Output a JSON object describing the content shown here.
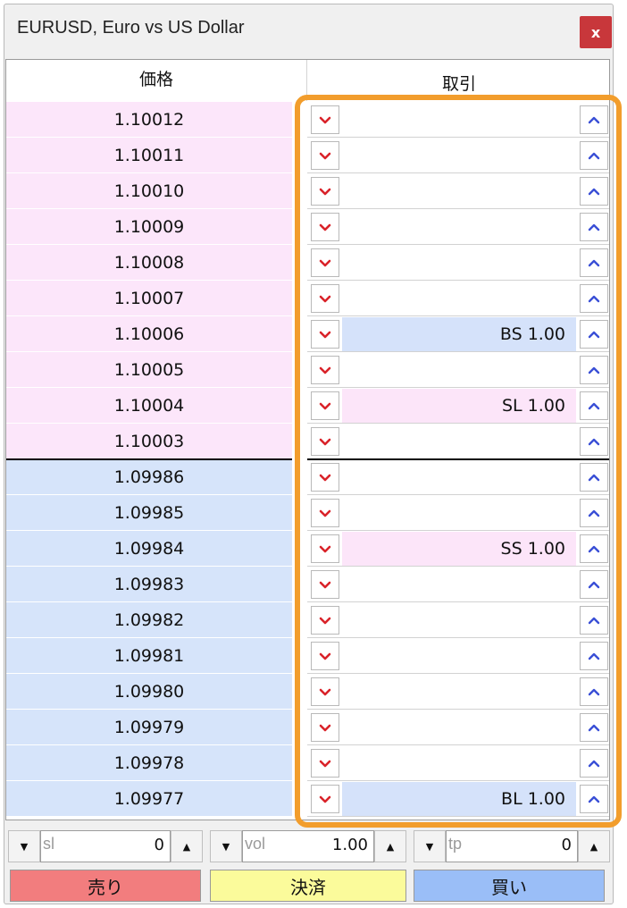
{
  "window": {
    "title": "EURUSD, Euro vs US Dollar",
    "close_label": "x"
  },
  "headers": {
    "price": "価格",
    "trade": "取引"
  },
  "price_rows": [
    {
      "price": "1.10012",
      "side": "ask",
      "order": ""
    },
    {
      "price": "1.10011",
      "side": "ask",
      "order": ""
    },
    {
      "price": "1.10010",
      "side": "ask",
      "order": ""
    },
    {
      "price": "1.10009",
      "side": "ask",
      "order": ""
    },
    {
      "price": "1.10008",
      "side": "ask",
      "order": ""
    },
    {
      "price": "1.10007",
      "side": "ask",
      "order": ""
    },
    {
      "price": "1.10006",
      "side": "ask",
      "order": "BS 1.00",
      "order_type": "buy"
    },
    {
      "price": "1.10005",
      "side": "ask",
      "order": ""
    },
    {
      "price": "1.10004",
      "side": "ask",
      "order": "SL 1.00",
      "order_type": "sell"
    },
    {
      "price": "1.10003",
      "side": "ask",
      "order": ""
    },
    {
      "price": "1.09986",
      "side": "bid",
      "order": ""
    },
    {
      "price": "1.09985",
      "side": "bid",
      "order": ""
    },
    {
      "price": "1.09984",
      "side": "bid",
      "order": "SS 1.00",
      "order_type": "sell"
    },
    {
      "price": "1.09983",
      "side": "bid",
      "order": ""
    },
    {
      "price": "1.09982",
      "side": "bid",
      "order": ""
    },
    {
      "price": "1.09981",
      "side": "bid",
      "order": ""
    },
    {
      "price": "1.09980",
      "side": "bid",
      "order": ""
    },
    {
      "price": "1.09979",
      "side": "bid",
      "order": ""
    },
    {
      "price": "1.09978",
      "side": "bid",
      "order": ""
    },
    {
      "price": "1.09977",
      "side": "bid",
      "order": "BL 1.00",
      "order_type": "buy"
    }
  ],
  "controls": {
    "sl": {
      "label": "sl",
      "value": "0"
    },
    "vol": {
      "label": "vol",
      "value": "1.00"
    },
    "tp": {
      "label": "tp",
      "value": "0"
    }
  },
  "actions": {
    "sell": "売り",
    "close": "決済",
    "buy": "買い"
  },
  "colors": {
    "ask_bg": "#fce6fa",
    "bid_bg": "#d6e4fa",
    "down_arrow": "#d9232a",
    "up_arrow": "#3a4fd6",
    "highlight": "#f29d2c",
    "sell_btn": "#f27d7e",
    "close_btn": "#fbfb9b",
    "buy_btn": "#9abef7",
    "close_x": "#c8373b"
  },
  "icons": {
    "down": "chevron-down-icon",
    "up": "chevron-up-icon"
  }
}
